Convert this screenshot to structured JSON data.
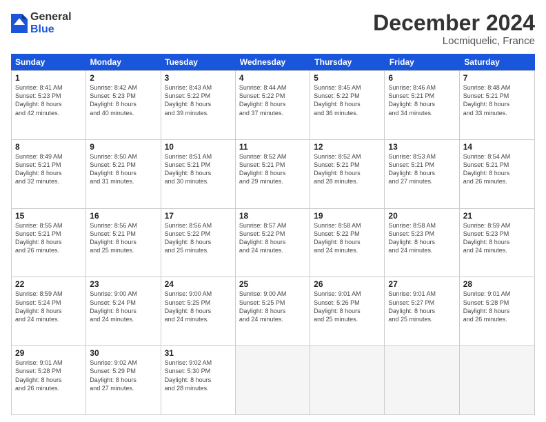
{
  "logo": {
    "general": "General",
    "blue": "Blue"
  },
  "title": "December 2024",
  "location": "Locmiquelic, France",
  "days": [
    "Sunday",
    "Monday",
    "Tuesday",
    "Wednesday",
    "Thursday",
    "Friday",
    "Saturday"
  ],
  "weeks": [
    [
      {
        "num": "1",
        "info": "Sunrise: 8:41 AM\nSunset: 5:23 PM\nDaylight: 8 hours\nand 42 minutes."
      },
      {
        "num": "2",
        "info": "Sunrise: 8:42 AM\nSunset: 5:23 PM\nDaylight: 8 hours\nand 40 minutes."
      },
      {
        "num": "3",
        "info": "Sunrise: 8:43 AM\nSunset: 5:22 PM\nDaylight: 8 hours\nand 39 minutes."
      },
      {
        "num": "4",
        "info": "Sunrise: 8:44 AM\nSunset: 5:22 PM\nDaylight: 8 hours\nand 37 minutes."
      },
      {
        "num": "5",
        "info": "Sunrise: 8:45 AM\nSunset: 5:22 PM\nDaylight: 8 hours\nand 36 minutes."
      },
      {
        "num": "6",
        "info": "Sunrise: 8:46 AM\nSunset: 5:21 PM\nDaylight: 8 hours\nand 34 minutes."
      },
      {
        "num": "7",
        "info": "Sunrise: 8:48 AM\nSunset: 5:21 PM\nDaylight: 8 hours\nand 33 minutes."
      }
    ],
    [
      {
        "num": "8",
        "info": "Sunrise: 8:49 AM\nSunset: 5:21 PM\nDaylight: 8 hours\nand 32 minutes."
      },
      {
        "num": "9",
        "info": "Sunrise: 8:50 AM\nSunset: 5:21 PM\nDaylight: 8 hours\nand 31 minutes."
      },
      {
        "num": "10",
        "info": "Sunrise: 8:51 AM\nSunset: 5:21 PM\nDaylight: 8 hours\nand 30 minutes."
      },
      {
        "num": "11",
        "info": "Sunrise: 8:52 AM\nSunset: 5:21 PM\nDaylight: 8 hours\nand 29 minutes."
      },
      {
        "num": "12",
        "info": "Sunrise: 8:52 AM\nSunset: 5:21 PM\nDaylight: 8 hours\nand 28 minutes."
      },
      {
        "num": "13",
        "info": "Sunrise: 8:53 AM\nSunset: 5:21 PM\nDaylight: 8 hours\nand 27 minutes."
      },
      {
        "num": "14",
        "info": "Sunrise: 8:54 AM\nSunset: 5:21 PM\nDaylight: 8 hours\nand 26 minutes."
      }
    ],
    [
      {
        "num": "15",
        "info": "Sunrise: 8:55 AM\nSunset: 5:21 PM\nDaylight: 8 hours\nand 26 minutes."
      },
      {
        "num": "16",
        "info": "Sunrise: 8:56 AM\nSunset: 5:21 PM\nDaylight: 8 hours\nand 25 minutes."
      },
      {
        "num": "17",
        "info": "Sunrise: 8:56 AM\nSunset: 5:22 PM\nDaylight: 8 hours\nand 25 minutes."
      },
      {
        "num": "18",
        "info": "Sunrise: 8:57 AM\nSunset: 5:22 PM\nDaylight: 8 hours\nand 24 minutes."
      },
      {
        "num": "19",
        "info": "Sunrise: 8:58 AM\nSunset: 5:22 PM\nDaylight: 8 hours\nand 24 minutes."
      },
      {
        "num": "20",
        "info": "Sunrise: 8:58 AM\nSunset: 5:23 PM\nDaylight: 8 hours\nand 24 minutes."
      },
      {
        "num": "21",
        "info": "Sunrise: 8:59 AM\nSunset: 5:23 PM\nDaylight: 8 hours\nand 24 minutes."
      }
    ],
    [
      {
        "num": "22",
        "info": "Sunrise: 8:59 AM\nSunset: 5:24 PM\nDaylight: 8 hours\nand 24 minutes."
      },
      {
        "num": "23",
        "info": "Sunrise: 9:00 AM\nSunset: 5:24 PM\nDaylight: 8 hours\nand 24 minutes."
      },
      {
        "num": "24",
        "info": "Sunrise: 9:00 AM\nSunset: 5:25 PM\nDaylight: 8 hours\nand 24 minutes."
      },
      {
        "num": "25",
        "info": "Sunrise: 9:00 AM\nSunset: 5:25 PM\nDaylight: 8 hours\nand 24 minutes."
      },
      {
        "num": "26",
        "info": "Sunrise: 9:01 AM\nSunset: 5:26 PM\nDaylight: 8 hours\nand 25 minutes."
      },
      {
        "num": "27",
        "info": "Sunrise: 9:01 AM\nSunset: 5:27 PM\nDaylight: 8 hours\nand 25 minutes."
      },
      {
        "num": "28",
        "info": "Sunrise: 9:01 AM\nSunset: 5:28 PM\nDaylight: 8 hours\nand 26 minutes."
      }
    ],
    [
      {
        "num": "29",
        "info": "Sunrise: 9:01 AM\nSunset: 5:28 PM\nDaylight: 8 hours\nand 26 minutes."
      },
      {
        "num": "30",
        "info": "Sunrise: 9:02 AM\nSunset: 5:29 PM\nDaylight: 8 hours\nand 27 minutes."
      },
      {
        "num": "31",
        "info": "Sunrise: 9:02 AM\nSunset: 5:30 PM\nDaylight: 8 hours\nand 28 minutes."
      },
      {
        "num": "",
        "info": ""
      },
      {
        "num": "",
        "info": ""
      },
      {
        "num": "",
        "info": ""
      },
      {
        "num": "",
        "info": ""
      }
    ]
  ]
}
